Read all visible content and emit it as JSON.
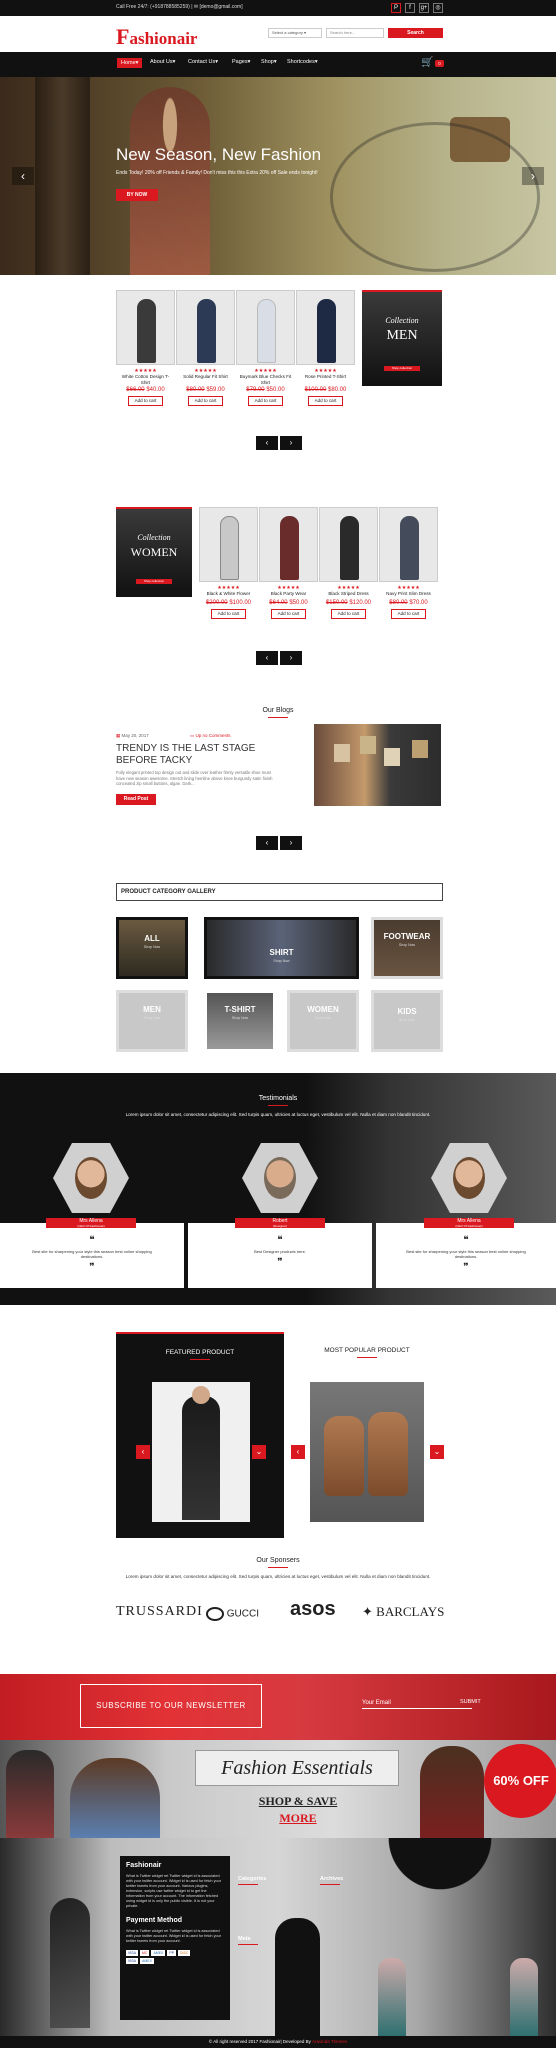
{
  "topbar": {
    "phone": "Call Free 24/7: (+918788585259) | ✉ [demo@gmail.com]",
    "social": [
      "P",
      "f",
      "g+",
      "◎"
    ]
  },
  "header": {
    "logo_f": "F",
    "logo_rest": "ashionair",
    "category": "Select a category",
    "search_placeholder": "Search here...",
    "search_btn": "Search"
  },
  "nav": {
    "items": [
      "Home▾",
      "About Us▾",
      "Contact Us▾",
      "Pages▾",
      "Shop▾",
      "Shortcodes▾"
    ],
    "cart_count": "0"
  },
  "hero": {
    "title": "New Season, New Fashion",
    "subtitle": "Ends Today! 20% off Friends & Family! Don't miss this this Extra 20% off Sale ends tonight!",
    "button": "BY NOW"
  },
  "men_products": [
    {
      "name": "White Cotton Design T-Shirt",
      "old": "$66.00",
      "new": "$40.00",
      "color": "#3a3a3a"
    },
    {
      "name": "Solid Regular Fit Shirt",
      "old": "$80.00",
      "new": "$59.00",
      "color": "#2d3a55"
    },
    {
      "name": "Buymark Blue Checks Fit Shirt",
      "old": "$79.00",
      "new": "$50.00",
      "color": "#d8dde6"
    },
    {
      "name": "Rose Printed T-Shirt",
      "old": "$100.00",
      "new": "$80.00",
      "color": "#1e2a44"
    }
  ],
  "men_collection": {
    "script": "Collection",
    "title": "MEN",
    "btn": "Shop collection"
  },
  "women_collection": {
    "script": "Collection",
    "title": "WOMEN",
    "btn": "Shop collection"
  },
  "women_products": [
    {
      "name": "Black & White Flower",
      "old": "$200.00",
      "new": "$100.00",
      "color": "#c8c8c8"
    },
    {
      "name": "Black Party Wear",
      "old": "$64.00",
      "new": "$50.00",
      "color": "#6a2b2b"
    },
    {
      "name": "Black Striped Dress",
      "old": "$150.00",
      "new": "$120.00",
      "color": "#2a2a2a"
    },
    {
      "name": "Navy Print Slim Dress",
      "old": "$80.00",
      "new": "$70.00",
      "color": "#444b5a"
    }
  ],
  "stars": "★★★★★",
  "add_to_cart": "Add to cart",
  "blog": {
    "heading": "Our Blogs",
    "date": "May 20, 2017",
    "comments": "Up no Comments",
    "title_line1": "TRENDY IS THE LAST STAGE",
    "title_line2": "BEFORE TACKY",
    "excerpt": "Fully elegant printed top design out and slide over leather firmly versatile shoe must have new season awesome. Stretch lining hemline above knee burgundy satin finish concealed zip small buttons, algae. Dark...",
    "btn": "Read Post"
  },
  "category": {
    "title": "PRODUCT CATEGORY GALLERY",
    "items": [
      {
        "name": "ALL",
        "sub": "Shop Now"
      },
      {
        "name": "SHIRT",
        "sub": "Shop Now"
      },
      {
        "name": "FOOTWEAR",
        "sub": "Shop Now"
      },
      {
        "name": "MEN",
        "sub": "Shop Now"
      },
      {
        "name": "T-SHIRT",
        "sub": "Shop Now"
      },
      {
        "name": "WOMEN",
        "sub": "Shop Now"
      },
      {
        "name": "KIDS",
        "sub": "Shop Now"
      }
    ]
  },
  "testimonials": {
    "heading": "Testimonials",
    "intro": "Lorem ipsum dolor sit amet, consectetur adipiscing elit. Sed turpis quam, ultricies at luctus eget, vestibulum vel elit. Nulla et diam non blandit tincidunt.",
    "items": [
      {
        "name": "Mrs Allena",
        "role": "(CEO Of Fashionair)",
        "text": "Best site for sharpening your style this season best online shopping destinations."
      },
      {
        "name": "Robert",
        "role": "(Designer)",
        "text": "Best Designer products here."
      },
      {
        "name": "Mrs Allena",
        "role": "(CEO Of Fashionair)",
        "text": "Best site for sharpening your style this season best online shopping destinations."
      }
    ]
  },
  "featured": {
    "title": "FEATURED PRODUCT"
  },
  "popular": {
    "title": "MOST POPULAR PRODUCT"
  },
  "sponsors": {
    "heading": "Our Sponsers",
    "text": "Lorem ipsum dolor sit amet, consectetur adipiscing elit. Sed turpis quam, ultricies at luctus eget, vestibulum vel elit. Nulla et diam non blandit tincidunt.",
    "logos": [
      "TRUSSARDI",
      "GUCCI",
      "asos",
      "BARCLAYS"
    ]
  },
  "newsletter": {
    "title": "SUBSCRIBE TO OUR NEWSLETTER",
    "email": "Your Email",
    "submit": "SUBMIT"
  },
  "essentials": {
    "title": "Fashion Essentials",
    "shop": "SHOP & SAVE",
    "more": "MORE",
    "badge": "60% OFF"
  },
  "footer": {
    "box_title": "Fashionair",
    "box_text": "What is Twitter widget ret Twitter widget id is associated with your twitter account. Widget id is used for fetch your twitter tweets from your account. Various plugins, extension, scripts use twitter widget id to get the information from your account. The information fetched using widget id is only the public visible. It is not your private.",
    "payment_title": "Payment Method",
    "payment_text": "What is Twitter widget ret Twitter widget id is associated with your twitter account. Widget id is used for fetch your twitter tweets from your account.",
    "cards": [
      "VISA",
      "MC",
      "AMEX",
      "PP",
      "DISC",
      "VISA",
      "AMEX"
    ],
    "col1": "Categories",
    "col2": "Archives",
    "col3": "Meta",
    "copyright": "© All right reserved 2017 Fashionair| Developed By",
    "dev": "Aravinda Themes"
  }
}
